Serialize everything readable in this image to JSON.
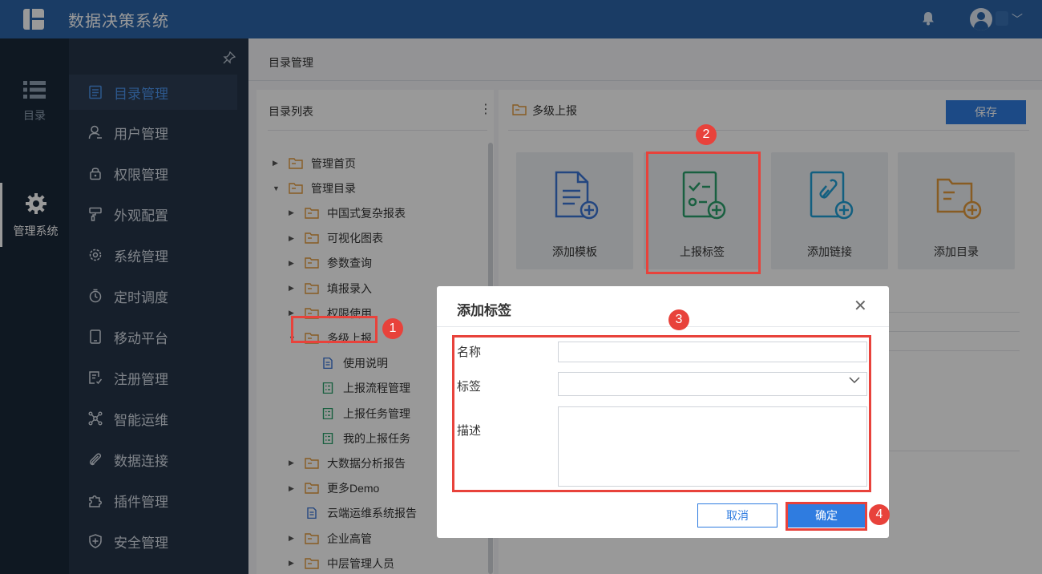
{
  "app": {
    "title": "数据决策系统"
  },
  "rail": [
    {
      "label": "目录",
      "icon": "list-icon"
    },
    {
      "label": "管理系统",
      "icon": "gear-icon"
    }
  ],
  "sidebar": {
    "items": [
      {
        "label": "目录管理",
        "icon": "catalog-icon"
      },
      {
        "label": "用户管理",
        "icon": "user-icon"
      },
      {
        "label": "权限管理",
        "icon": "lock-icon"
      },
      {
        "label": "外观配置",
        "icon": "brush-icon"
      },
      {
        "label": "系统管理",
        "icon": "settings-icon"
      },
      {
        "label": "定时调度",
        "icon": "timer-icon"
      },
      {
        "label": "移动平台",
        "icon": "tablet-icon"
      },
      {
        "label": "注册管理",
        "icon": "register-icon"
      },
      {
        "label": "智能运维",
        "icon": "network-icon"
      },
      {
        "label": "数据连接",
        "icon": "paperclip-icon"
      },
      {
        "label": "插件管理",
        "icon": "puzzle-icon"
      },
      {
        "label": "安全管理",
        "icon": "shield-icon"
      }
    ]
  },
  "breadcrumb": "目录管理",
  "tree": {
    "title": "目录列表",
    "more": "⋮",
    "rows": [
      {
        "label": "管理首页",
        "type": "folder",
        "toggle": "▶",
        "level": 0
      },
      {
        "label": "管理目录",
        "type": "folder",
        "toggle": "▼",
        "level": 0
      },
      {
        "label": "中国式复杂报表",
        "type": "folder",
        "toggle": "▶",
        "level": 1
      },
      {
        "label": "可视化图表",
        "type": "folder",
        "toggle": "▶",
        "level": 1
      },
      {
        "label": "参数查询",
        "type": "folder",
        "toggle": "▶",
        "level": 1
      },
      {
        "label": "填报录入",
        "type": "folder",
        "toggle": "▶",
        "level": 1
      },
      {
        "label": "权限使用",
        "type": "folder",
        "toggle": "▶",
        "level": 1
      },
      {
        "label": "多级上报",
        "type": "folder",
        "toggle": "▼",
        "level": 1
      },
      {
        "label": "使用说明",
        "type": "doc",
        "toggle": "",
        "level": 2
      },
      {
        "label": "上报流程管理",
        "type": "form",
        "toggle": "",
        "level": 2
      },
      {
        "label": "上报任务管理",
        "type": "form",
        "toggle": "",
        "level": 2
      },
      {
        "label": "我的上报任务",
        "type": "form",
        "toggle": "",
        "level": 2
      },
      {
        "label": "大数据分析报告",
        "type": "folder",
        "toggle": "▶",
        "level": 1
      },
      {
        "label": "更多Demo",
        "type": "folder",
        "toggle": "▶",
        "level": 1
      },
      {
        "label": "云端运维系统报告",
        "type": "doc",
        "toggle": "",
        "level": 1
      },
      {
        "label": "企业高管",
        "type": "folder",
        "toggle": "▶",
        "level": 1
      },
      {
        "label": "中层管理人员",
        "type": "folder",
        "toggle": "▶",
        "level": 1
      }
    ]
  },
  "main": {
    "title": "多级上报",
    "save_label": "保存",
    "cards": [
      {
        "label": "添加模板",
        "icon": "add-template-icon"
      },
      {
        "label": "上报标签",
        "icon": "report-tag-icon"
      },
      {
        "label": "添加链接",
        "icon": "add-link-icon"
      },
      {
        "label": "添加目录",
        "icon": "add-folder-icon"
      }
    ]
  },
  "dialog": {
    "title": "添加标签",
    "close": "✕",
    "fields": [
      {
        "label": "名称",
        "value": "",
        "type": "text"
      },
      {
        "label": "标签",
        "value": "",
        "type": "select"
      },
      {
        "label": "描述",
        "value": "",
        "type": "textarea"
      }
    ],
    "cancel_label": "取消",
    "ok_label": "确定"
  },
  "annotations": [
    "1",
    "2",
    "3",
    "4"
  ],
  "colors": {
    "brand": "#2c64a8",
    "accent": "#2f7ce0",
    "highlight": "#e8423b",
    "sidebar": "#253448",
    "rail": "#1a283a"
  }
}
